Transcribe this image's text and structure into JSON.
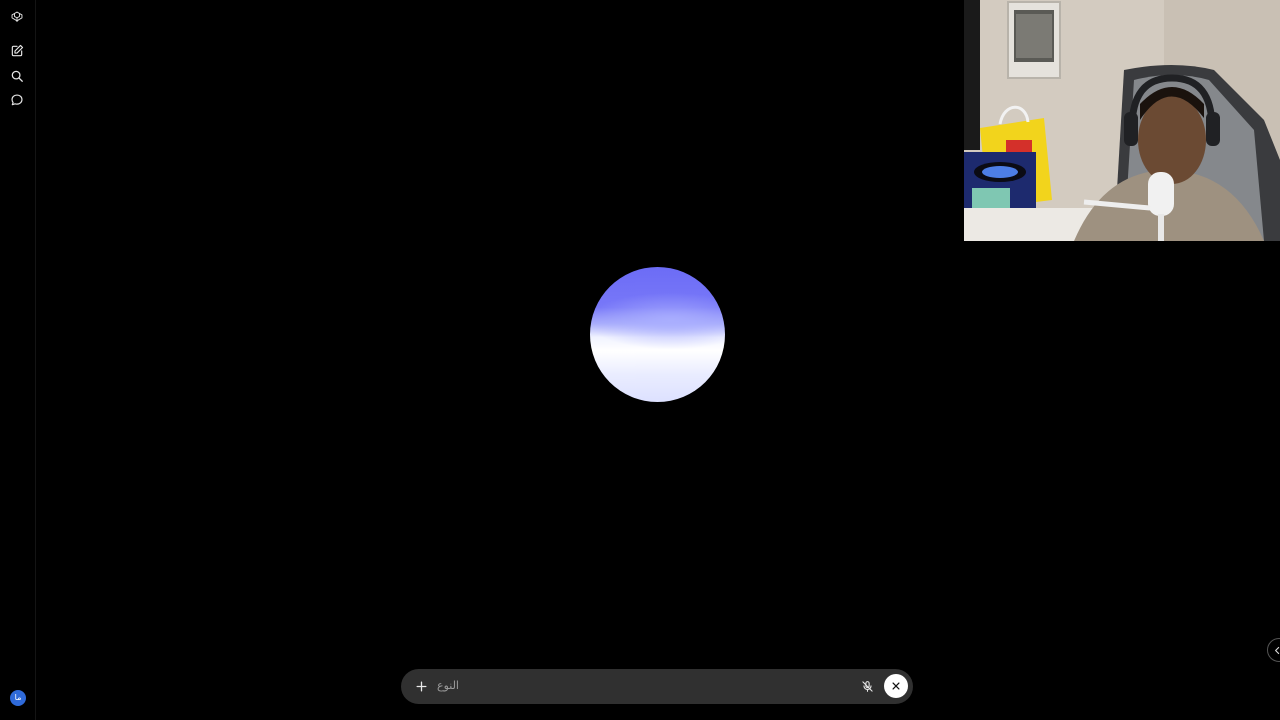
{
  "sidebar": {
    "logo_icon": "openai-logo-icon",
    "new_chat_icon": "new-chat-icon",
    "search_icon": "search-icon",
    "chats_icon": "chat-bubble-icon",
    "avatar_initials": "ما",
    "avatar_color": "#2f6ad9"
  },
  "voice": {
    "orb_colors": [
      "#6c6cf6",
      "#ffffff",
      "#dde1ff"
    ]
  },
  "composer": {
    "placeholder": "النوع",
    "plus_icon": "plus-icon",
    "mic_icon": "mic-muted-icon",
    "close_icon": "close-icon"
  },
  "edge_tab": {
    "icon": "chevron-left-icon"
  }
}
